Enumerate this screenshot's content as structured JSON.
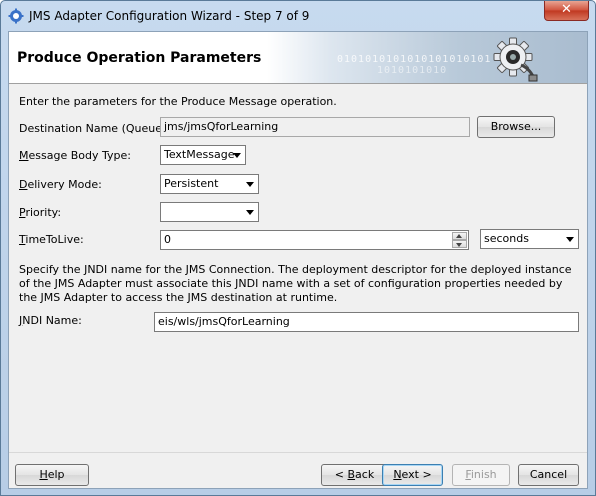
{
  "window": {
    "title": "JMS Adapter Configuration Wizard - Step 7 of 9",
    "close_label": "✕"
  },
  "header": {
    "title": "Produce Operation Parameters",
    "binary_line1": "0101010101010101010101",
    "binary_line2": "1010101010"
  },
  "intro": "Enter the parameters for the Produce Message operation.",
  "fields": {
    "destination": {
      "label": "Destination Name (Queue):",
      "value": "jms/jmsQforLearning",
      "button": "Browse..."
    },
    "body_type": {
      "label_u": "M",
      "label_rest": "essage Body Type:",
      "value": "TextMessage"
    },
    "delivery": {
      "label_u": "D",
      "label_rest": "elivery Mode:",
      "value": "Persistent"
    },
    "priority": {
      "label_u": "P",
      "label_rest": "riority:",
      "value": ""
    },
    "ttl": {
      "label_u": "T",
      "label_rest": "imeToLive:",
      "value": "0",
      "unit": "seconds"
    },
    "jndi": {
      "label_u": "J",
      "label_rest": "NDI Name:",
      "value": "eis/wls/jmsQforLearning"
    }
  },
  "description": "Specify the JNDI name for the JMS Connection.  The deployment descriptor for the deployed instance of the JMS Adapter must associate this JNDI name with a set of configuration properties needed by the JMS Adapter to access the JMS destination at runtime.",
  "footer": {
    "help": {
      "u": "H",
      "rest": "elp"
    },
    "back": {
      "pre": "< ",
      "u": "B",
      "rest": "ack"
    },
    "next": {
      "u": "N",
      "rest": "ext >"
    },
    "finish": {
      "u": "F",
      "rest": "inish"
    },
    "cancel": "Cancel"
  }
}
